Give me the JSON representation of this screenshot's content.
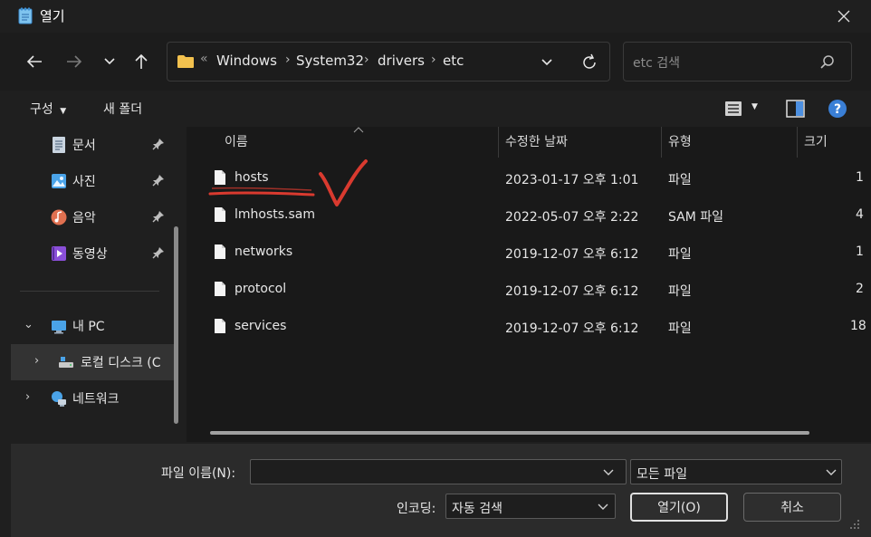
{
  "window": {
    "title": "열기"
  },
  "address": {
    "overflow": "«",
    "crumbs": [
      "Windows",
      "System32",
      "drivers",
      "etc"
    ]
  },
  "search": {
    "placeholder": "etc 검색"
  },
  "toolbar": {
    "organize": "구성",
    "new_folder": "새 폴더"
  },
  "sidebar": {
    "items": [
      {
        "label": "문서",
        "icon": "document-icon"
      },
      {
        "label": "사진",
        "icon": "pictures-icon"
      },
      {
        "label": "음악",
        "icon": "music-icon"
      },
      {
        "label": "동영상",
        "icon": "video-icon"
      },
      {
        "label": "내 PC",
        "icon": "pc-icon"
      },
      {
        "label": "로컬 디스크 (C",
        "icon": "drive-icon"
      },
      {
        "label": "네트워크",
        "icon": "network-icon"
      }
    ]
  },
  "columns": {
    "name": "이름",
    "date": "수정한 날짜",
    "type": "유형",
    "size": "크기"
  },
  "files": [
    {
      "name": "hosts",
      "date": "2023-01-17 오후 1:01",
      "type": "파일",
      "size": "1"
    },
    {
      "name": "lmhosts.sam",
      "date": "2022-05-07 오후 2:22",
      "type": "SAM 파일",
      "size": "4"
    },
    {
      "name": "networks",
      "date": "2019-12-07 오후 6:12",
      "type": "파일",
      "size": "1"
    },
    {
      "name": "protocol",
      "date": "2019-12-07 오후 6:12",
      "type": "파일",
      "size": "2"
    },
    {
      "name": "services",
      "date": "2019-12-07 오후 6:12",
      "type": "파일",
      "size": "18"
    }
  ],
  "bottom": {
    "filename_label": "파일 이름(N):",
    "filename_value": "",
    "filetype": "모든 파일",
    "encoding_label": "인코딩:",
    "encoding": "자동 검색",
    "open": "열기(O)",
    "cancel": "취소"
  },
  "colors": {
    "annotation": "#d93a2f",
    "accent": "#4c8fe0"
  }
}
